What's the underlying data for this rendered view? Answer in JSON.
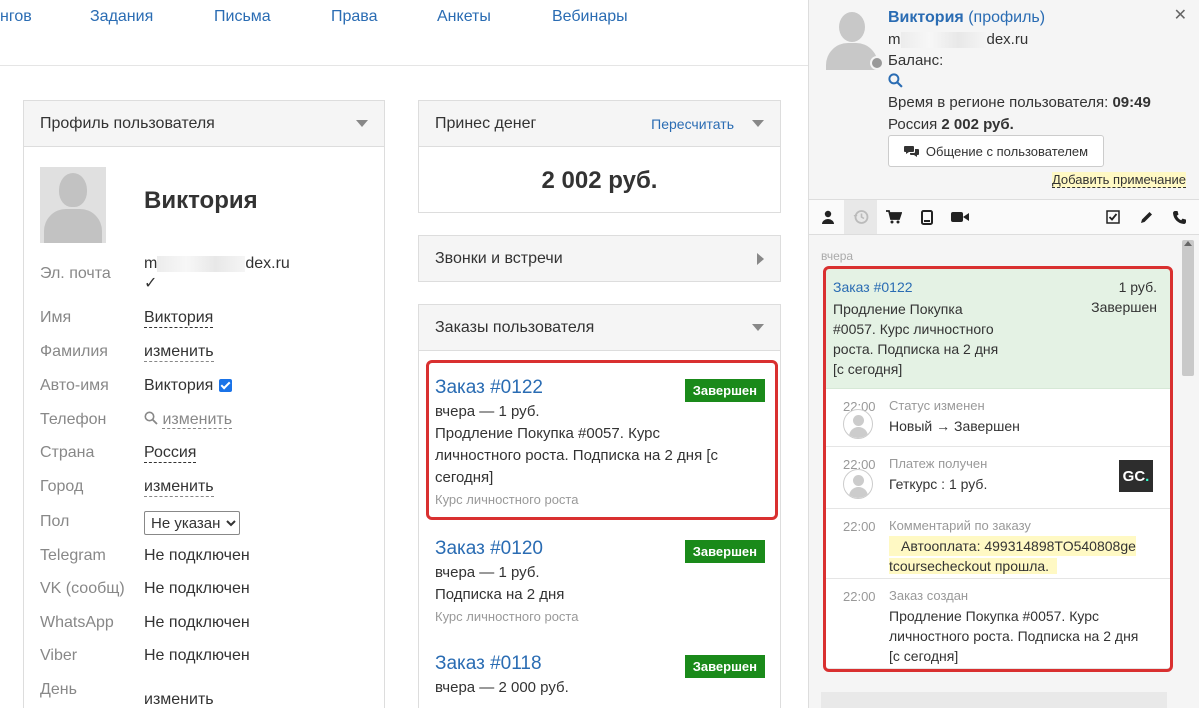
{
  "topnav": {
    "items": [
      "нгов",
      "Задания",
      "Письма",
      "Права",
      "Анкеты",
      "Вебинары"
    ]
  },
  "profile": {
    "title": "Профиль пользователя",
    "name": "Виктория",
    "email_start": "m",
    "email_end": "dex.ru",
    "fields": [
      {
        "label": "Эл. почта"
      },
      {
        "label": "Имя",
        "value": "Виктория"
      },
      {
        "label": "Фамилия",
        "value": "изменить"
      },
      {
        "label": "Авто-имя",
        "value": "Виктория"
      },
      {
        "label": "Телефон",
        "value": "изменить"
      },
      {
        "label": "Страна",
        "value": "Россия"
      },
      {
        "label": "Город",
        "value": "изменить"
      },
      {
        "label": "Пол",
        "value": "Не указан"
      },
      {
        "label": "Telegram",
        "value": "Не подключен"
      },
      {
        "label": "VK (сообщ)",
        "value": "Не подключен"
      },
      {
        "label": "WhatsApp",
        "value": "Не подключен"
      },
      {
        "label": "Viber",
        "value": "Не подключен"
      },
      {
        "label": "День",
        "value": "изменить"
      }
    ]
  },
  "money": {
    "title": "Принес денег",
    "recalc": "Пересчитать",
    "amount": "2 002 руб."
  },
  "calls": {
    "title": "Звонки и встречи"
  },
  "orders": {
    "title": "Заказы пользователя",
    "items": [
      {
        "title": "Заказ #0122",
        "status": "Завершен",
        "line1": "вчера — 1 руб.",
        "line2": "Продление Покупка #0057. Курс",
        "line3": "личностного роста. Подписка на 2 дня [с",
        "line4": "сегодня]",
        "course": "Курс личностного роста"
      },
      {
        "title": "Заказ #0120",
        "status": "Завершен",
        "line1": "вчера — 1 руб.",
        "line2": "Подписка на 2 дня",
        "course": "Курс личностного роста"
      },
      {
        "title": "Заказ #0118",
        "status": "Завершен",
        "line1": "вчера — 2 000 руб."
      }
    ]
  },
  "side": {
    "name": "Виктория",
    "profile_link": "(профиль)",
    "email_start": "m",
    "email_end": "dex.ru",
    "balance": "Баланс:",
    "region_time_label": "Время в регионе пользователя:",
    "region_time": "09:49",
    "country": "Россия",
    "country_amount": "2 002 руб.",
    "chat_button": "Общение с пользователем",
    "add_note": "Добавить примечание",
    "feed_day": "вчера",
    "order_card": {
      "title": "Заказ #0122",
      "amount": "1 руб.",
      "status": "Завершен",
      "line1": "Продление Покупка",
      "line2": "#0057. Курс личностного",
      "line3": "роста. Подписка на 2 дня",
      "line4": "[с сегодня]"
    },
    "events": [
      {
        "time": "22:00",
        "title": "Статус изменен",
        "text": "Новый → Завершен"
      },
      {
        "time": "22:00",
        "title": "Платеж получен",
        "text": "Геткурс : 1 руб."
      },
      {
        "time": "22:00",
        "title": "Комментарий по заказу",
        "text1": "Автооплата: 499314898TO540808ge",
        "text2": "tcoursecheckout прошла."
      },
      {
        "time": "22:00",
        "title": "Заказ создан",
        "text1": "Продление Покупка #0057. Курс",
        "text2": "личностного роста. Подписка на 2 дня",
        "text3": "[с сегодня]"
      }
    ]
  }
}
